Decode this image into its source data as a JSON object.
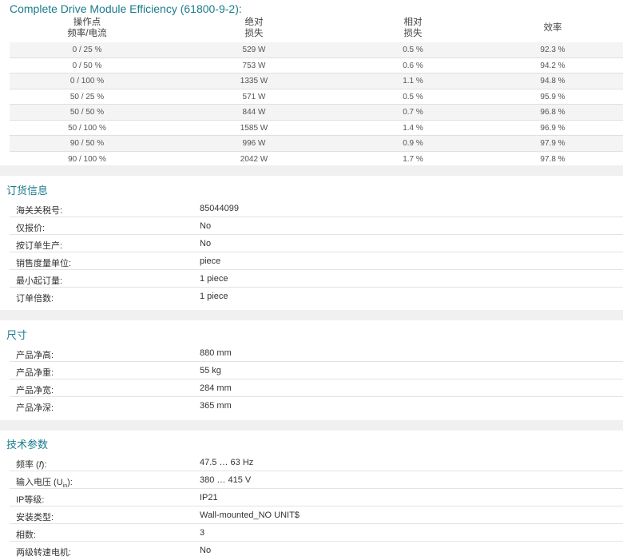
{
  "efficiency": {
    "title": "Complete Drive Module Efficiency (61800-9-2):",
    "headers": {
      "col1_line1": "操作点",
      "col1_line2": "频率/电流",
      "col2_line1": "绝对",
      "col2_line2": "损失",
      "col3_line1": "相对",
      "col3_line2": "损失",
      "col4": "效率"
    },
    "rows": [
      {
        "point": "0 / 25 %",
        "abs": "529 W",
        "rel": "0.5 %",
        "eff": "92.3 %"
      },
      {
        "point": "0 / 50 %",
        "abs": "753 W",
        "rel": "0.6 %",
        "eff": "94.2 %"
      },
      {
        "point": "0 / 100 %",
        "abs": "1335 W",
        "rel": "1.1 %",
        "eff": "94.8 %"
      },
      {
        "point": "50 / 25 %",
        "abs": "571 W",
        "rel": "0.5 %",
        "eff": "95.9 %"
      },
      {
        "point": "50 / 50 %",
        "abs": "844 W",
        "rel": "0.7 %",
        "eff": "96.8 %"
      },
      {
        "point": "50 / 100 %",
        "abs": "1585 W",
        "rel": "1.4 %",
        "eff": "96.9 %"
      },
      {
        "point": "90 / 50 %",
        "abs": "996 W",
        "rel": "0.9 %",
        "eff": "97.9 %"
      },
      {
        "point": "90 / 100 %",
        "abs": "2042 W",
        "rel": "1.7 %",
        "eff": "97.8 %"
      }
    ]
  },
  "ordering": {
    "title": "订货信息",
    "rows": [
      {
        "k": "海关关税号:",
        "v": "85044099"
      },
      {
        "k": "仅报价:",
        "v": "No"
      },
      {
        "k": "按订单生产:",
        "v": "No"
      },
      {
        "k": "销售度量单位:",
        "v": "piece"
      },
      {
        "k": "最小起订量:",
        "v": "1 piece"
      },
      {
        "k": "订单倍数:",
        "v": "1 piece"
      }
    ]
  },
  "dimensions": {
    "title": "尺寸",
    "rows": [
      {
        "k": "产品净高:",
        "v": "880 mm"
      },
      {
        "k": "产品净重:",
        "v": "55 kg"
      },
      {
        "k": "产品净宽:",
        "v": "284 mm"
      },
      {
        "k": "产品净深:",
        "v": "365 mm"
      }
    ]
  },
  "technical": {
    "title": "技术参数",
    "freq_label": "频率 (",
    "freq_symbol": "f",
    "freq_label_end": "):",
    "freq_value": "47.5 … 63 Hz",
    "voltage_label": "输入电压 (U",
    "voltage_sub": "in",
    "voltage_label_end": "):",
    "voltage_value": "380 … 415 V",
    "rows": [
      {
        "k": "IP等级:",
        "v": "IP21"
      },
      {
        "k": "安装类型:",
        "v": "Wall-mounted_NO UNIT$"
      },
      {
        "k": "相数:",
        "v": "3"
      },
      {
        "k": "两级转速电机:",
        "v": "No"
      }
    ]
  }
}
